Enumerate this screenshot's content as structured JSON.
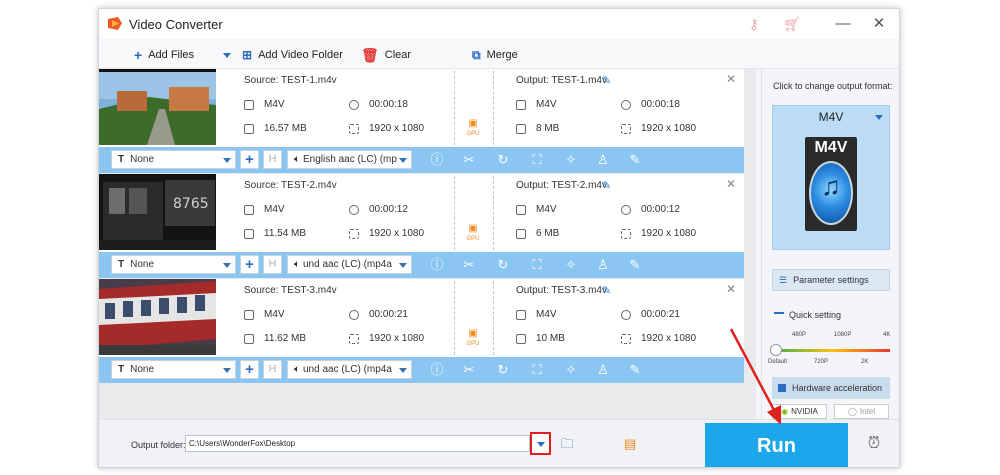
{
  "window": {
    "title": "Video Converter"
  },
  "toolbar": {
    "add_files": "Add Files",
    "add_video_folder": "Add Video Folder",
    "clear": "Clear",
    "merge": "Merge"
  },
  "items": [
    {
      "source": "Source: TEST-1.m4v",
      "output": "Output: TEST-1.m4v",
      "src_format": "M4V",
      "src_duration": "00:00:18",
      "src_size": "16.57 MB",
      "src_res": "1920 x 1080",
      "dst_format": "M4V",
      "dst_duration": "00:00:18",
      "dst_size": "8 MB",
      "dst_res": "1920 x 1080",
      "subtitle": "None",
      "audio": "English aac (LC) (mp"
    },
    {
      "source": "Source: TEST-2.m4v",
      "output": "Output: TEST-2.m4v",
      "src_format": "M4V",
      "src_duration": "00:00:12",
      "src_size": "11.54 MB",
      "src_res": "1920 x 1080",
      "dst_format": "M4V",
      "dst_duration": "00:00:12",
      "dst_size": "6 MB",
      "dst_res": "1920 x 1080",
      "subtitle": "None",
      "audio": "und aac (LC) (mp4a"
    },
    {
      "source": "Source: TEST-3.m4v",
      "output": "Output: TEST-3.m4v",
      "src_format": "M4V",
      "src_duration": "00:00:21",
      "src_size": "11.62 MB",
      "src_res": "1920 x 1080",
      "dst_format": "M4V",
      "dst_duration": "00:00:21",
      "dst_size": "10 MB",
      "dst_res": "1920 x 1080",
      "subtitle": "None",
      "audio": "und aac (LC) (mp4a"
    }
  ],
  "gpu_label": "GPU",
  "side": {
    "click_label": "Click to change output format:",
    "format": "M4V",
    "icon_text": "M4V",
    "parameter_settings": "Parameter settings",
    "quick_setting": "Quick setting",
    "ticks_top": [
      "480P",
      "1080P",
      "4K"
    ],
    "ticks_bottom": [
      "Default",
      "720P",
      "2K"
    ],
    "hardware_acceleration": "Hardware acceleration",
    "nvidia": "NVIDIA",
    "intel": "Intel"
  },
  "footer": {
    "output_folder_label": "Output folder:",
    "output_path": "C:\\Users\\WonderFox\\Desktop",
    "run": "Run"
  },
  "colors": {
    "accent": "#1da6ea",
    "bar": "#8bc6f2",
    "arrow": "#e02020"
  }
}
